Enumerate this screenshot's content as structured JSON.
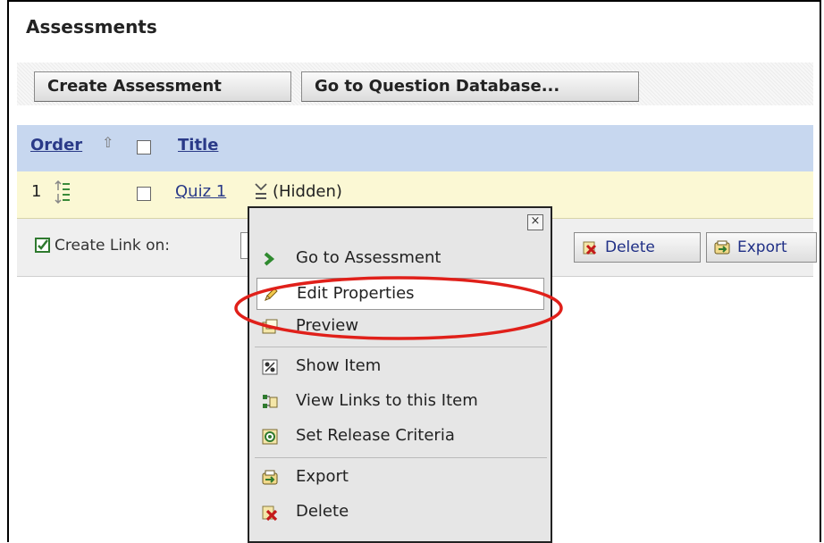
{
  "page": {
    "title": "Assessments"
  },
  "toolbar": {
    "create_label": "Create Assessment",
    "qdb_label": "Go to Question Database..."
  },
  "table": {
    "headers": {
      "order": "Order",
      "title": "Title"
    },
    "rows": [
      {
        "order": "1",
        "title": "Quiz 1",
        "status": "(Hidden)"
      }
    ]
  },
  "action_bar": {
    "link_label": "Create Link on:",
    "delete_label": "Delete",
    "export_label": "Export"
  },
  "context_menu": {
    "items": [
      {
        "label": "Go to Assessment",
        "icon": "green-arrow-icon"
      },
      {
        "label": "Edit Properties",
        "icon": "pencil-icon"
      },
      {
        "label": "Preview",
        "icon": "preview-icon"
      },
      {
        "label": "Show Item",
        "icon": "show-item-icon"
      },
      {
        "label": "View Links to this Item",
        "icon": "links-icon"
      },
      {
        "label": "Set Release Criteria",
        "icon": "release-criteria-icon"
      },
      {
        "label": "Export",
        "icon": "export-icon"
      },
      {
        "label": "Delete",
        "icon": "delete-icon"
      }
    ]
  },
  "colors": {
    "header_bg": "#c7d7ef",
    "row_bg": "#fbf8d4",
    "link": "#2a3a88",
    "highlight_oval": "#e0201a"
  }
}
